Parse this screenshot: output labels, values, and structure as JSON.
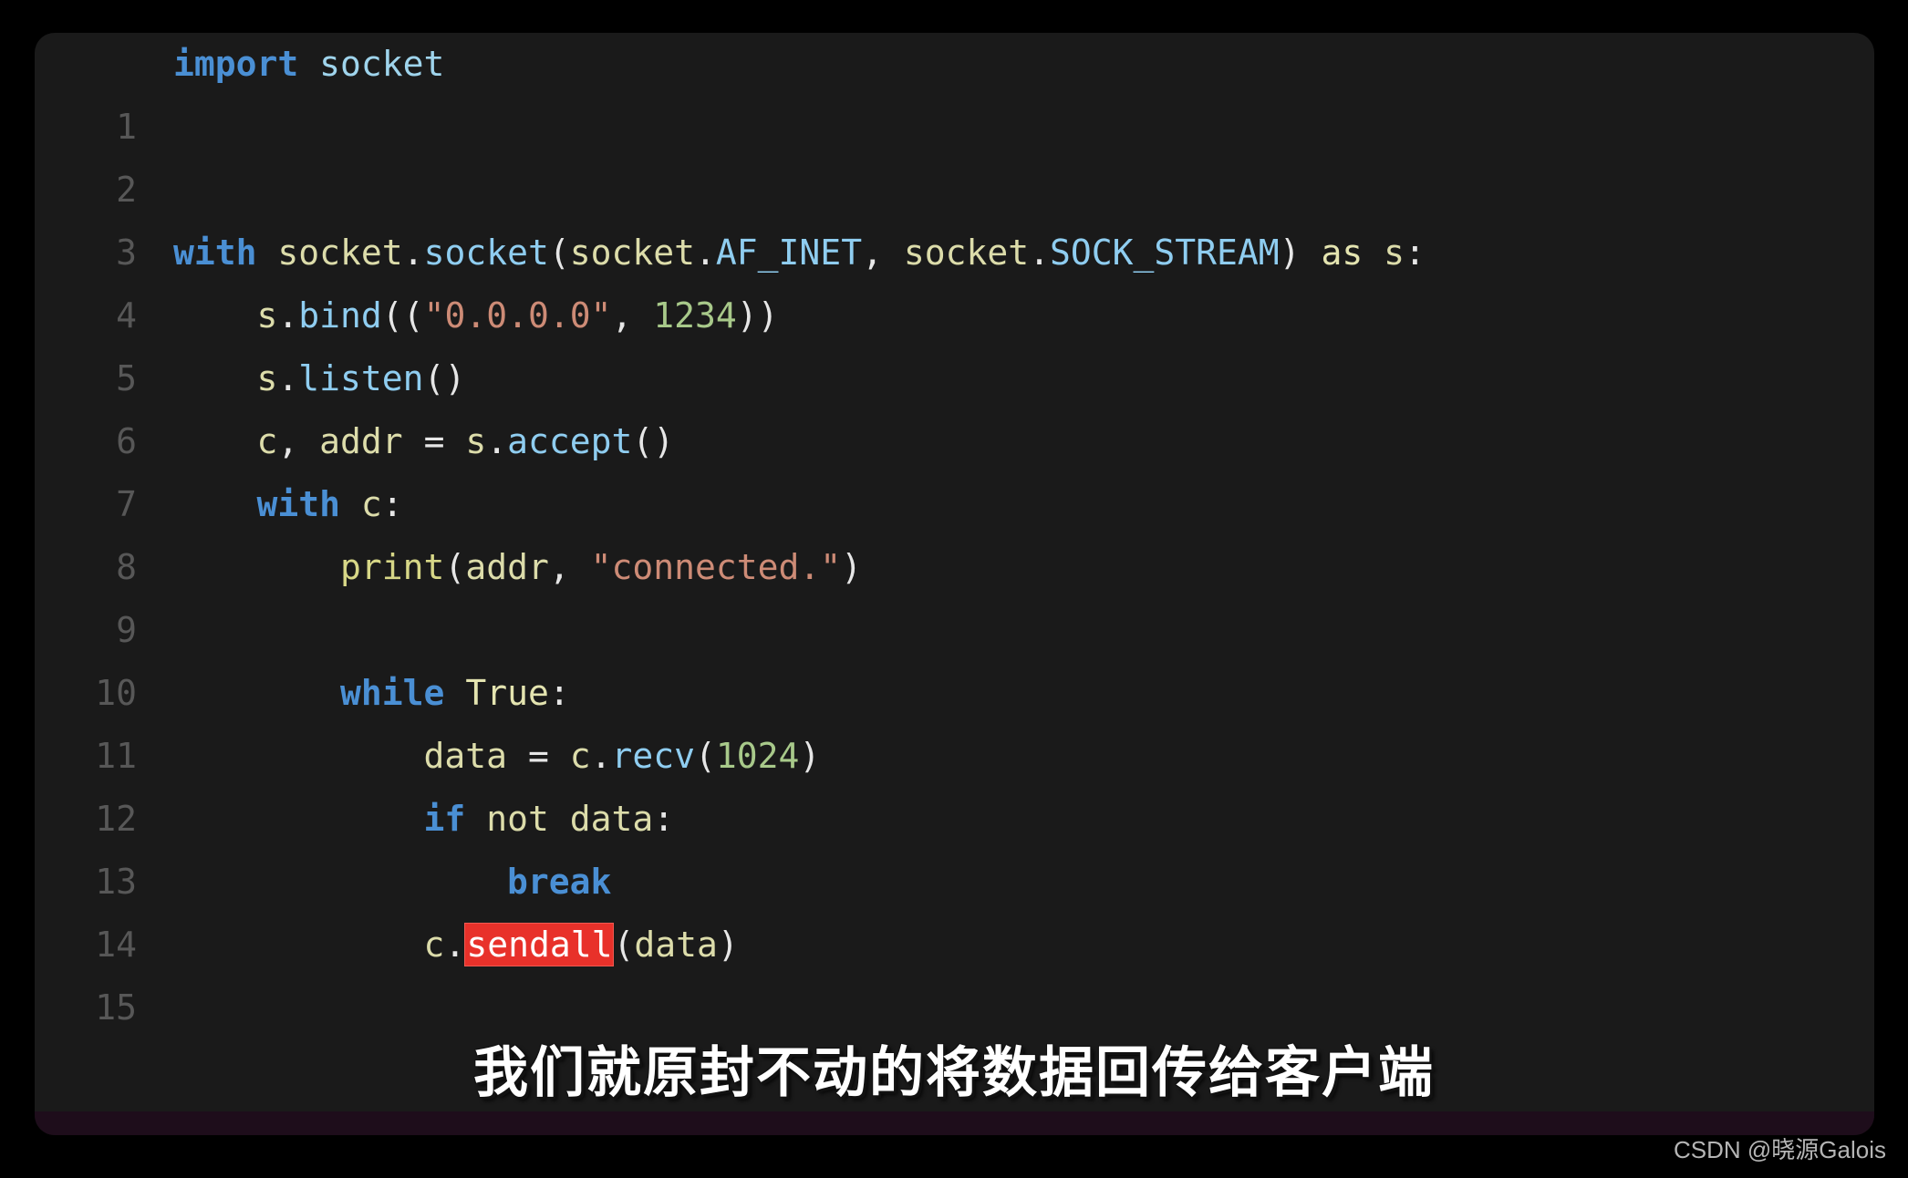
{
  "editor": {
    "background_color": "#1a1a1a",
    "page_background_color": "#000000",
    "status_strip_color": "#1e0d1b",
    "line_number_color": "#575757",
    "highlight_color": "#e8312a",
    "lines": [
      {
        "number": "1",
        "text": "import socket"
      },
      {
        "number": "2",
        "text": ""
      },
      {
        "number": "3",
        "text": ""
      },
      {
        "number": "4",
        "text": "with socket.socket(socket.AF_INET, socket.SOCK_STREAM) as s:"
      },
      {
        "number": "5",
        "text": "    s.bind((\"0.0.0.0\", 1234))"
      },
      {
        "number": "6",
        "text": "    s.listen()"
      },
      {
        "number": "7",
        "text": "    c, addr = s.accept()"
      },
      {
        "number": "8",
        "text": "    with c:"
      },
      {
        "number": "9",
        "text": "        print(addr, \"connected.\")"
      },
      {
        "number": "10",
        "text": ""
      },
      {
        "number": "11",
        "text": "        while True:"
      },
      {
        "number": "12",
        "text": "            data = c.recv(1024)"
      },
      {
        "number": "13",
        "text": "            if not data:"
      },
      {
        "number": "14",
        "text": "                break"
      },
      {
        "number": "15",
        "text": "            c.sendall(data)"
      }
    ],
    "highlighted_token": "sendall",
    "highlighted_line_number": "15"
  },
  "subtitle": {
    "text": "我们就原封不动的将数据回传给客户端"
  },
  "watermark": {
    "text": "CSDN @晓源Galois"
  }
}
